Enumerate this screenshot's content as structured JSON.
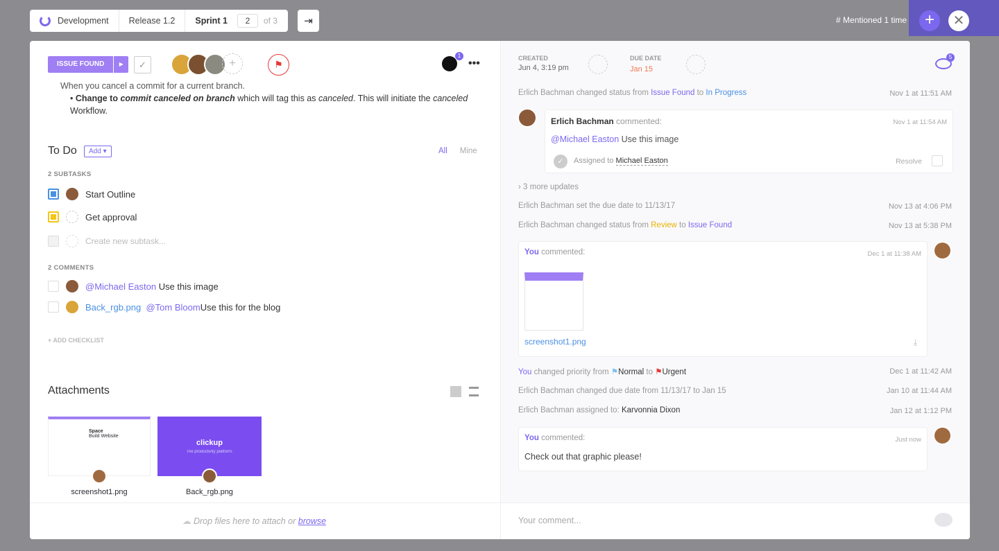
{
  "breadcrumb": {
    "items": [
      "Development",
      "Release 1.2",
      "Sprint 1"
    ],
    "page": "2",
    "of": "of 3"
  },
  "topbar": {
    "mentioned": "Mentioned 1 time",
    "hash": "#"
  },
  "task": {
    "status": "ISSUE FOUND",
    "github_badge": "1",
    "watchers": "5",
    "desc_line1": "When you cancel a commit for a current branch.",
    "desc_b1": "Change to ",
    "desc_b2": "commit canceled on branch",
    "desc_b3": " which will tag this as ",
    "desc_b4": "canceled",
    ". This will initiate the ": "",
    "desc_b5": ". This will initiate the ",
    "desc_b6": "canceled",
    "desc_b7": " Workflow."
  },
  "todo": {
    "title": "To Do",
    "add": "Add",
    "tab_all": "All",
    "tab_mine": "Mine",
    "subtasks_label": "2 SUBTASKS",
    "subtasks": [
      "Start Outline",
      "Get approval"
    ],
    "new_placeholder": "Create new subtask...",
    "comments_label": "2 COMMENTS",
    "comments": [
      {
        "mention": "@Michael Easton",
        "text": " Use this image"
      },
      {
        "file": "Back_rgb.png",
        "mention": "@Tom Bloom",
        "text": "Use this for the blog"
      }
    ],
    "add_checklist": "+ ADD CHECKLIST"
  },
  "attachments": {
    "title": "Attachments",
    "files": [
      "screenshot1.png",
      "Back_rgb.png"
    ],
    "thumb_space": "Space",
    "thumb_build": "Build Website",
    "thumb_brand": "clickup",
    "thumb_tag": "The productivity platform."
  },
  "dropzone": {
    "text": "Drop files here to attach or ",
    "browse": "browse"
  },
  "meta": {
    "created_label": "CREATED",
    "created": "Jun 4, 3:19 pm",
    "due_label": "DUE DATE",
    "due": "Jan 15"
  },
  "activity": {
    "a1": {
      "who": "Erlich Bachman changed status from ",
      "from": "Issue Found",
      "to_word": " to ",
      "to": "In Progress",
      "ts": "Nov 1 at 11:51 AM"
    },
    "c1": {
      "who": "Erlich Bachman",
      "verb": " commented:",
      "ts": "Nov 1 at 11:54 AM",
      "mention": "@Michael Easton",
      "text": " Use this image",
      "assigned": "Assigned to ",
      "assignee": "Michael Easton",
      "resolve": "Resolve"
    },
    "more": "3 more updates",
    "a2": {
      "text": "Erlich Bachman set the due date to 11/13/17",
      "ts": "Nov 13 at 4:06 PM"
    },
    "a3": {
      "who": "Erlich Bachman changed status from ",
      "from": "Review",
      "to_word": " to ",
      "to": "Issue Found",
      "ts": "Nov 13 at 5:38 PM"
    },
    "c2": {
      "who": "You",
      "verb": " commented:",
      "ts": "Dec 1 at 11:38 AM",
      "file": "screenshot1.png"
    },
    "a4": {
      "who": "You",
      "text": " changed priority from ",
      "from": "Normal",
      "to_word": " to ",
      "to": "Urgent",
      "ts": "Dec 1 at 11:42 AM"
    },
    "a5": {
      "text": "Erlich Bachman changed due date from 11/13/17 to Jan 15",
      "ts": "Jan 10 at 11:44 AM"
    },
    "a6": {
      "text": "Erlich Bachman assigned to: ",
      "who": "Karvonnia Dixon",
      "ts": "Jan 12 at 1:12 PM"
    },
    "c3": {
      "who": "You",
      "verb": " commented:",
      "ts": "Just now",
      "text": "Check out that graphic please!"
    }
  },
  "comment_input": {
    "placeholder": "Your comment..."
  },
  "colors": {
    "accent": "#7b68ee",
    "status": "#9f7ff3",
    "urgent": "#e53935",
    "review": "#f5c518",
    "blue": "#4a90e2"
  }
}
